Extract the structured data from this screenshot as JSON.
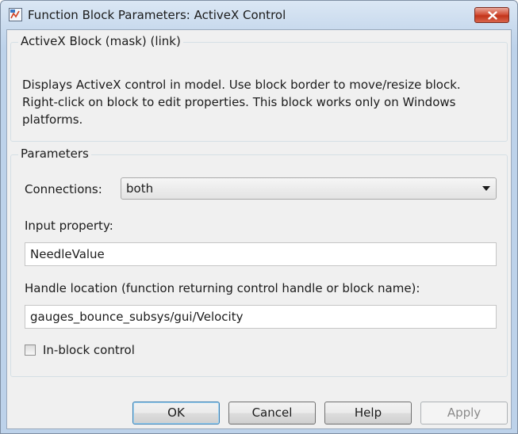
{
  "window": {
    "title": "Function Block Parameters: ActiveX Control",
    "icons": {
      "app": "simulink-icon",
      "close": "close-icon"
    }
  },
  "block_group": {
    "legend": "ActiveX Block (mask) (link)",
    "description": "Displays ActiveX control in model. Use block border to move/resize block. Right-click on block to edit properties. This block works only on Windows platforms."
  },
  "parameters": {
    "legend": "Parameters",
    "connections_label": "Connections:",
    "connections_value": "both",
    "input_property_label": "Input property:",
    "input_property_value": "NeedleValue",
    "handle_location_label": "Handle location (function returning control handle or block name):",
    "handle_location_value": "gauges_bounce_subsys/gui/Velocity",
    "in_block_control_label": "In-block control",
    "in_block_control_checked": false
  },
  "buttons": {
    "ok": "OK",
    "cancel": "Cancel",
    "help": "Help",
    "apply": "Apply"
  },
  "colors": {
    "title_bar": "#c7d9ed",
    "close_button": "#c2341b",
    "dialog_background": "#f0f0f0",
    "default_button_border": "#3c7fb1"
  }
}
